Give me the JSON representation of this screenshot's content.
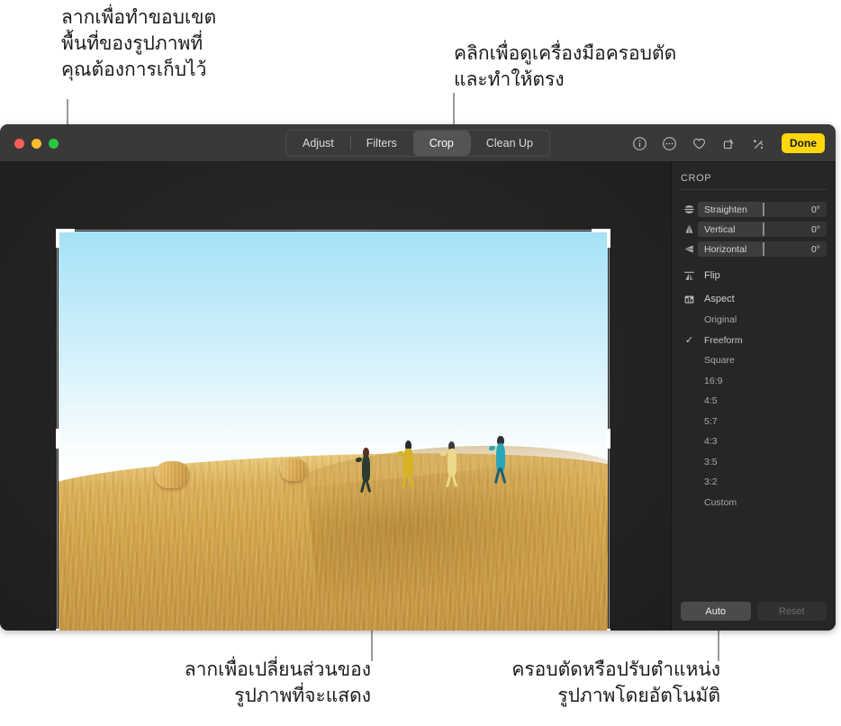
{
  "callouts": {
    "top_left": "ลากเพื่อทำขอบเขต\nพื้นที่ของรูปภาพที่\nคุณต้องการเก็บไว้",
    "top_right": "คลิกเพื่อดูเครื่องมือครอบตัด\nและทำให้ตรง",
    "bottom_left": "ลากเพื่อเปลี่ยนส่วนของ\nรูปภาพที่จะแสดง",
    "bottom_right": "ครอบตัดหรือปรับตำแหน่ง\nรูปภาพโดยอัตโนมัติ"
  },
  "window": {
    "traffic_lights": [
      "close",
      "minimize",
      "zoom"
    ]
  },
  "toolbar": {
    "tabs": [
      {
        "label": "Adjust",
        "selected": false
      },
      {
        "label": "Filters",
        "selected": false
      },
      {
        "label": "Crop",
        "selected": true
      },
      {
        "label": "Clean Up",
        "selected": false
      }
    ],
    "actions": [
      {
        "name": "info-icon"
      },
      {
        "name": "more-options-icon"
      },
      {
        "name": "heart-icon"
      },
      {
        "name": "rotate-icon"
      },
      {
        "name": "magic-wand-icon"
      }
    ],
    "done_label": "Done",
    "done_color": "#ffd60a"
  },
  "inspector": {
    "title": "CROP",
    "sliders": [
      {
        "icon": "straighten-icon",
        "label": "Straighten",
        "value": "0°"
      },
      {
        "icon": "vertical-icon",
        "label": "Vertical",
        "value": "0°"
      },
      {
        "icon": "horizontal-icon",
        "label": "Horizontal",
        "value": "0°"
      }
    ],
    "tools": [
      {
        "icon": "flip-icon",
        "label": "Flip"
      },
      {
        "icon": "aspect-icon",
        "label": "Aspect"
      }
    ],
    "aspect_ratios": [
      {
        "label": "Original",
        "selected": false
      },
      {
        "label": "Freeform",
        "selected": true
      },
      {
        "label": "Square",
        "selected": false
      },
      {
        "label": "16:9",
        "selected": false
      },
      {
        "label": "4:5",
        "selected": false
      },
      {
        "label": "5:7",
        "selected": false
      },
      {
        "label": "4:3",
        "selected": false
      },
      {
        "label": "3:5",
        "selected": false
      },
      {
        "label": "3:2",
        "selected": false
      },
      {
        "label": "Custom",
        "selected": false
      }
    ],
    "check_glyph": "✓",
    "auto_label": "Auto",
    "reset_label": "Reset"
  },
  "photo": {
    "description": "Four people running along a golden harvested wheat field ridge with two round hay bales under a pale blue sky",
    "sky_color": "#a5e2f7",
    "field_color": "#d2a448",
    "runners": [
      {
        "name": "runner-dark",
        "color": "#2c3c30"
      },
      {
        "name": "runner-mustard",
        "color": "#d8b324"
      },
      {
        "name": "runner-pale-yellow",
        "color": "#ecd98a"
      },
      {
        "name": "runner-teal",
        "color": "#2aa6b8"
      }
    ]
  }
}
